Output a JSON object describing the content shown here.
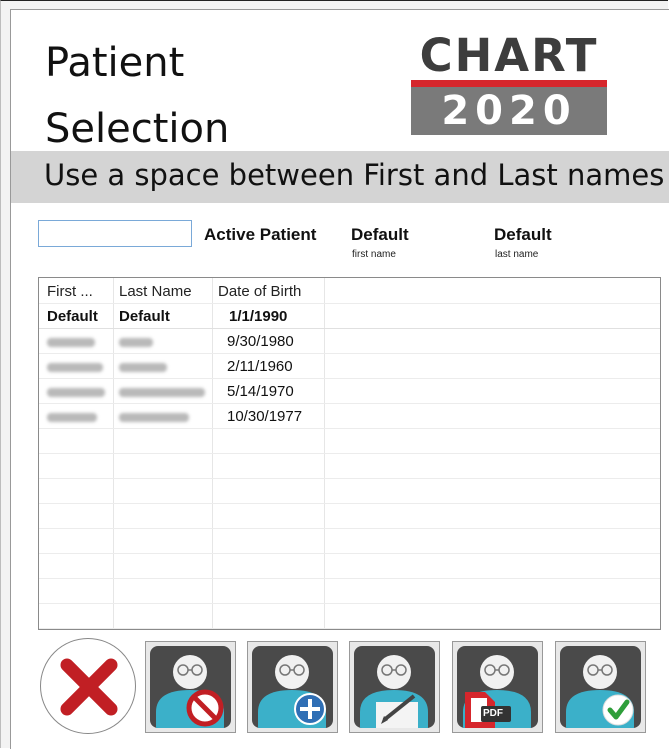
{
  "header": {
    "title_line1": "Patient",
    "title_line2": "Selection",
    "logo_top": "CHART",
    "logo_bottom": "2020"
  },
  "hint": "Use a space between First and Last names",
  "search": {
    "value": "",
    "placeholder": ""
  },
  "active_patient": {
    "label": "Active Patient",
    "first_name": "Default",
    "first_name_caption": "first name",
    "last_name": "Default",
    "last_name_caption": "last name"
  },
  "table": {
    "columns": [
      "First ...",
      "Last Name",
      "Date of Birth"
    ],
    "rows": [
      {
        "first": "Default",
        "last": "Default",
        "dob": "1/1/1990",
        "bold": true
      },
      {
        "first": "",
        "last": "",
        "dob": "9/30/1980"
      },
      {
        "first": "",
        "last": "",
        "dob": "2/11/1960"
      },
      {
        "first": "",
        "last": "",
        "dob": "5/14/1970"
      },
      {
        "first": "",
        "last": "",
        "dob": "10/30/1977"
      }
    ]
  },
  "buttons": [
    {
      "name": "cancel-button",
      "icon": "red-x-icon"
    },
    {
      "name": "delete-patient-button",
      "icon": "patient-forbidden-icon"
    },
    {
      "name": "add-patient-button",
      "icon": "patient-add-icon"
    },
    {
      "name": "edit-patient-button",
      "icon": "patient-edit-icon"
    },
    {
      "name": "patient-pdf-button",
      "icon": "patient-pdf-icon",
      "badge": "PDF"
    },
    {
      "name": "select-patient-button",
      "icon": "patient-check-icon"
    }
  ],
  "colors": {
    "logo_red": "#d6262c",
    "logo_gray": "#7a7a7a",
    "hint_bar": "#d4d4d4",
    "avatar_body": "#3bb0c9",
    "button_bg": "#4a4a4a"
  }
}
